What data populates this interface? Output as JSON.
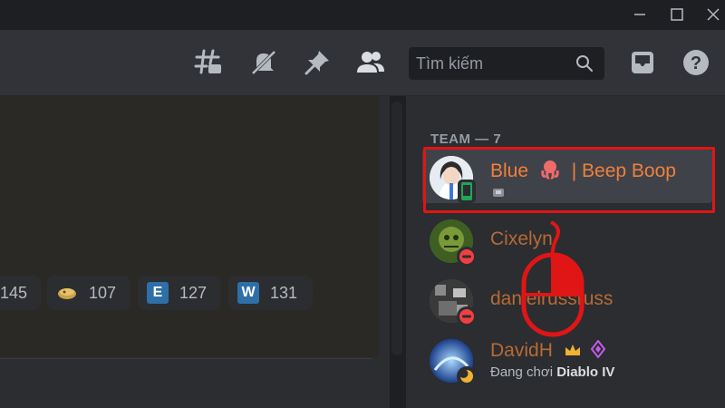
{
  "search": {
    "placeholder": "Tìm kiếm"
  },
  "header_icons": [
    "threads-icon",
    "mute-bell-icon",
    "pin-icon",
    "members-icon",
    "inbox-icon",
    "help-icon"
  ],
  "reactions": [
    {
      "icon": "partial-emoji",
      "count": "145"
    },
    {
      "icon": "bread-emoji",
      "count": "107"
    },
    {
      "letter": "E",
      "color": "#2f6fa8",
      "count": "127"
    },
    {
      "letter": "W",
      "color": "#2f6fa8",
      "count": "131"
    }
  ],
  "members": {
    "group_label": "TEAM — 7",
    "list": [
      {
        "name": "Blue",
        "name_suffix": "| Beep Boop",
        "status": "mobile-online",
        "subtitle": ""
      },
      {
        "name": "Cixelyn",
        "status": "do-not-disturb",
        "subtitle": ""
      },
      {
        "name": "danielrussruss",
        "status": "do-not-disturb",
        "subtitle": ""
      },
      {
        "name": "DavidH",
        "status": "idle",
        "activity_prefix": "Đang chơi",
        "activity_game": "Diablo IV"
      }
    ]
  },
  "colors": {
    "accent_name": "#f0803a",
    "highlight": "#e01515",
    "online": "#23a55a",
    "dnd": "#f23f43",
    "idle": "#f0b232"
  }
}
